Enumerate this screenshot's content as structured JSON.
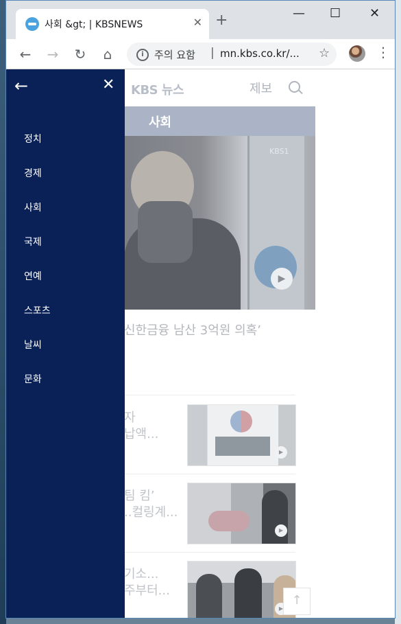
{
  "browser": {
    "tab_title": "사회 &gt; | KBSNEWS",
    "tab_close": "✕",
    "new_tab": "+",
    "minimize": "—",
    "maximize": "☐",
    "close": "✕",
    "back": "←",
    "forward": "→",
    "reload": "↻",
    "home": "⌂",
    "omnibox": {
      "warning": "주의 요함",
      "separator": "|",
      "url": "mn.kbs.co.kr/..."
    },
    "bookmark_star": "☆",
    "menu": "⋮",
    "icons": [
      "kbs-favicon-icon",
      "info-icon",
      "star-icon",
      "profile-avatar",
      "kebab-menu-icon"
    ]
  },
  "site": {
    "logo": "KBS 뉴스",
    "report": "제보",
    "section_title": "사회",
    "hero_badge": "KBS1",
    "headline": "신한금융 남산 3억원 의혹’",
    "items": [
      {
        "line1": "자",
        "line2": "납액..."
      },
      {
        "line1": "팀 킴’",
        "line2": "..컬링계..."
      },
      {
        "line1": "기소...",
        "line2": "주부터..."
      }
    ],
    "scroll_top": "↑",
    "play": "▶"
  },
  "drawer": {
    "back": "←",
    "close": "✕",
    "items": [
      "정치",
      "경제",
      "사회",
      "국제",
      "연예",
      "스포츠",
      "날씨",
      "문화"
    ]
  },
  "colors": {
    "drawer_bg": "#0a2158",
    "section_bar": "#aab4c6",
    "chrome_frame": "#dee1e6"
  }
}
